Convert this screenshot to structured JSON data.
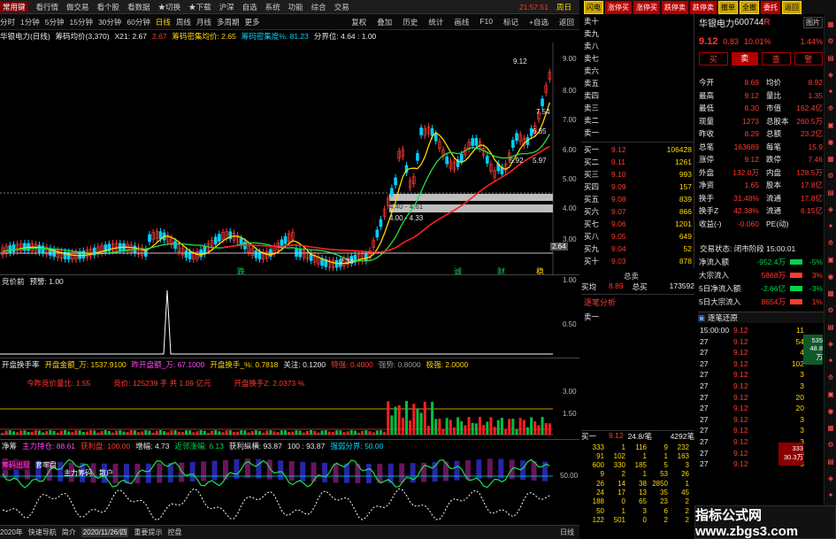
{
  "top_menu": {
    "app_label": "常用键",
    "items": [
      "看行情",
      "做交易",
      "看个股",
      "看数据",
      "★切换",
      "★下载",
      "沪深",
      "自选",
      "系统",
      "功能",
      "综合",
      "交易"
    ],
    "clock": "21:57:51",
    "weekday": "周日"
  },
  "period_tabs": [
    "分时",
    "1分钟",
    "5分钟",
    "15分钟",
    "30分钟",
    "60分钟",
    "日线",
    "周线",
    "月线",
    "多周期",
    "更多"
  ],
  "period_selected": "日线",
  "right_tools": [
    "复权",
    "叠加",
    "历史",
    "统计",
    "画线",
    "F10",
    "标记",
    "+自选",
    "返回"
  ],
  "main_chart": {
    "title": "华银电力(日线)",
    "indicator": "筹码均价(3,370)",
    "x21_label": "X21: 2.67",
    "x21_val": "2.67",
    "density_avg": "筹码密集均价: 2.65",
    "density_deg": "筹码密集度%: 81.23",
    "split": "分界位: 4.64 : 1.00",
    "y_ticks": [
      "9.00",
      "8.00",
      "7.00",
      "6.00",
      "5.00",
      "4.00",
      "3.00"
    ],
    "annotations": {
      "high": "9.12",
      "low": "2.34",
      "box1": "4.40 - 4.61",
      "box2": "4.00 - 4.33",
      "r1": "6.85",
      "r2": "5.97",
      "r3": "5.92",
      "r4": "7.54",
      "right_price": "2.64"
    },
    "markers": [
      "跌",
      "诚",
      "财",
      "稳"
    ]
  },
  "panel2": {
    "title": "竞价前",
    "pre": "预警: 1.00",
    "y_ticks": [
      "1.00",
      "0.50"
    ]
  },
  "panel3": {
    "title": "开盘换手率",
    "open_amt": "开盘金额_万: 1537.9100",
    "yesterday_amt": "昨开盘额_万: 67.1000",
    "open_turn": "开盘换手_%: 0.7818",
    "focus": "关注: 0.1200",
    "strong": "特强: 0.4000",
    "very": "强势: 0.8000",
    "extreme": "极强: 2.0000",
    "sub1": "今昨竞价量比: 1.55",
    "sub2": "竞价: 125239 手 共 1.09 亿元",
    "sub3": "开盘换手Z: 2.0373 %",
    "y_ticks": [
      "3.00",
      "1.50"
    ]
  },
  "panel4": {
    "title": "净筹",
    "a": "主力持仓: 88.61",
    "b": "获利盘: 100.00",
    "c": "增幅: 4.73",
    "d": "近邻涨幅: 6.13",
    "e": "获利纵横: 93.87",
    "f": "100 : 93.87",
    "g": "强弱分界: 50.00",
    "y_ticks": [
      "50.00"
    ],
    "labels": [
      "筹码出现",
      "套牢盘",
      "主力筹码",
      "散户"
    ]
  },
  "bottom_bar": {
    "date": "2020年",
    "date2": "2020/11/26/四",
    "items": [
      "2020年",
      "快速导航",
      "简介",
      "重要提示",
      "控盘"
    ],
    "right": "日线"
  },
  "quote": {
    "name": "华银电力",
    "code": "600744",
    "tag": "R",
    "price": "9.12",
    "change": "0.83",
    "pct": "10.01%",
    "pct2": "1.44%",
    "side_label": "卖 出",
    "buttons": [
      "买",
      "卖",
      "查",
      "警"
    ],
    "sell_labels": [
      "卖十",
      "卖九",
      "卖八",
      "卖七",
      "卖六",
      "卖五",
      "卖四",
      "卖三",
      "卖二",
      "卖一"
    ],
    "buy": [
      {
        "label": "买一",
        "price": "9.12",
        "vol": "106428"
      },
      {
        "label": "买二",
        "price": "9.11",
        "vol": "1261"
      },
      {
        "label": "买三",
        "price": "9.10",
        "vol": "993"
      },
      {
        "label": "买四",
        "price": "9.09",
        "vol": "157"
      },
      {
        "label": "买五",
        "price": "9.08",
        "vol": "839"
      },
      {
        "label": "买六",
        "price": "9.07",
        "vol": "866"
      },
      {
        "label": "买七",
        "price": "9.06",
        "vol": "1201"
      },
      {
        "label": "买八",
        "price": "9.05",
        "vol": "649"
      },
      {
        "label": "买九",
        "price": "9.04",
        "vol": "52"
      },
      {
        "label": "买十",
        "price": "9.03",
        "vol": "878"
      }
    ],
    "sell_avg": "总卖",
    "buy_avg_lbl": "买均",
    "buy_avg": "8.89",
    "total_buy_lbl": "总买",
    "total_buy": "173592",
    "analysis": "逐笔分析",
    "sell1": "卖一"
  },
  "stats": [
    {
      "a": "今开",
      "av": "8.69",
      "b": "均价",
      "bv": "8.92"
    },
    {
      "a": "最高",
      "av": "9.12",
      "b": "量比",
      "bv": "1.35"
    },
    {
      "a": "最低",
      "av": "8.30",
      "b": "市值",
      "bv": "162.4亿"
    },
    {
      "a": "现量",
      "av": "1273",
      "b": "总股本",
      "bv": "260.5万"
    },
    {
      "a": "昨收",
      "av": "8.29",
      "b": "总额",
      "bv": "23.2亿"
    },
    {
      "a": "总笔",
      "av": "163689",
      "b": "每笔",
      "bv": "15.9"
    },
    {
      "a": "涨停",
      "av": "9.12",
      "b": "跌停",
      "bv": "7.46"
    },
    {
      "a": "外盘",
      "av": "132.0万",
      "b": "内盘",
      "bv": "128.5万"
    },
    {
      "a": "净资",
      "av": "1.65",
      "b": "股本",
      "bv": "17.8亿"
    },
    {
      "a": "换手",
      "av": "31.48%",
      "b": "流通",
      "bv": "17.8亿"
    },
    {
      "a": "换手Z",
      "av": "42.38%",
      "b": "流通",
      "bv": "6.15亿"
    },
    {
      "a": "收益(-)",
      "av": "-0.060",
      "b": "PE(动)",
      "bv": ""
    }
  ],
  "trade_status": "交易状态: 闭市阶段 15:00:01",
  "flows": [
    {
      "k": "净流入额",
      "v": "-952.4万",
      "p": "-5%"
    },
    {
      "k": "大宗流入",
      "v": "5868万",
      "p": "3%"
    },
    {
      "k": "5日净流入额",
      "v": "-2.66亿",
      "p": "-3%"
    },
    {
      "k": "5日大宗流入",
      "v": "8654万",
      "p": "1%"
    }
  ],
  "ticks_title": "逐笔还原",
  "ticks": [
    {
      "t": "15:00:00",
      "p": "9.12",
      "v": "11"
    },
    {
      "t": "27",
      "p": "9.12",
      "v": "54"
    },
    {
      "t": "27",
      "p": "9.12",
      "v": "4"
    },
    {
      "t": "27",
      "p": "9.12",
      "v": "102"
    },
    {
      "t": "27",
      "p": "9.12",
      "v": "3"
    },
    {
      "t": "27",
      "p": "9.12",
      "v": "3"
    },
    {
      "t": "27",
      "p": "9.12",
      "v": "20"
    },
    {
      "t": "27",
      "p": "9.12",
      "v": "20"
    },
    {
      "t": "27",
      "p": "9.12",
      "v": "3"
    },
    {
      "t": "27",
      "p": "9.12",
      "v": "3"
    },
    {
      "t": "27",
      "p": "9.12",
      "v": "3"
    },
    {
      "t": "27",
      "p": "9.12",
      "v": "3"
    },
    {
      "t": "27",
      "p": "9.12",
      "v": "3"
    }
  ],
  "tick_box": {
    "a": "535",
    "b": "48.8万",
    "c": "333",
    "d": "30.3万"
  },
  "bottom_book": {
    "lbl": "买一",
    "p": "9.12",
    "v": "24.8/笔",
    "n": "4292笔"
  },
  "bottom_grid": [
    [
      "333",
      "1",
      "116",
      "9",
      "232"
    ],
    [
      "91",
      "102",
      "1",
      "1",
      "163"
    ],
    [
      "600",
      "330",
      "185",
      "5",
      "3"
    ],
    [
      "9",
      "2",
      "1",
      "53",
      "26"
    ],
    [
      "26",
      "14",
      "38",
      "2850",
      "1"
    ],
    [
      "24",
      "17",
      "13",
      "35",
      "45"
    ],
    [
      "188",
      "0",
      "65",
      "23",
      "2"
    ],
    [
      "50",
      "1",
      "3",
      "6",
      "2"
    ],
    [
      "122",
      "501",
      "0",
      "2",
      "2"
    ]
  ],
  "watermark": "指标公式网 www.zbgs3.com",
  "colors": {
    "up": "#ff3b30",
    "down": "#00d44a",
    "bg": "#000000",
    "price_line": "#ffd800"
  }
}
